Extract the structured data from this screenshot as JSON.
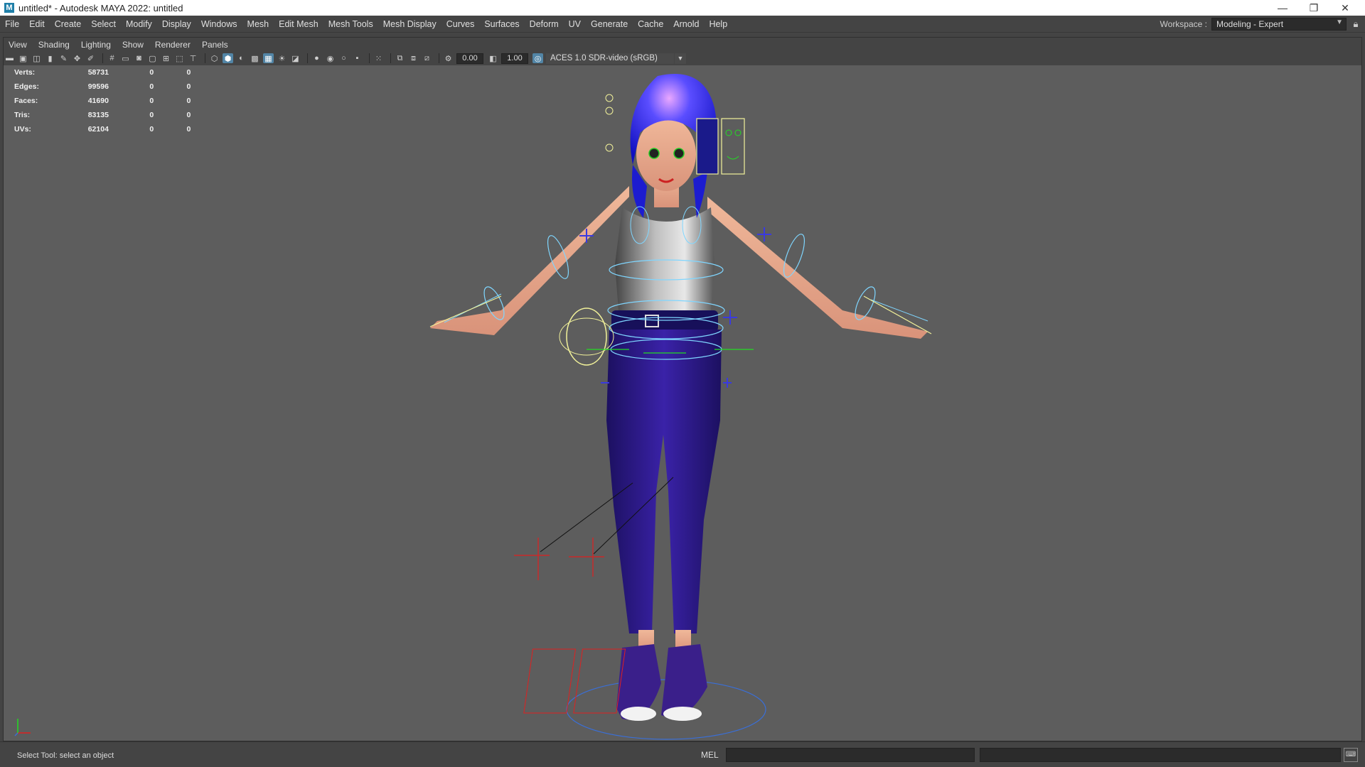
{
  "window": {
    "title": "untitled* - Autodesk MAYA 2022: untitled",
    "app_icon": "M",
    "controls": [
      "—",
      "❐",
      "✕"
    ]
  },
  "menubar": {
    "items": [
      "File",
      "Edit",
      "Create",
      "Select",
      "Modify",
      "Display",
      "Windows",
      "Mesh",
      "Edit Mesh",
      "Mesh Tools",
      "Mesh Display",
      "Curves",
      "Surfaces",
      "Deform",
      "UV",
      "Generate",
      "Cache",
      "Arnold",
      "Help"
    ]
  },
  "workspace": {
    "label": "Workspace :",
    "value": "Modeling - Expert"
  },
  "panel_menu": {
    "items": [
      "View",
      "Shading",
      "Lighting",
      "Show",
      "Renderer",
      "Panels"
    ]
  },
  "toolbar": {
    "exposure": "0.00",
    "gamma": "1.00",
    "color_space": "ACES 1.0 SDR-video (sRGB)"
  },
  "hud": {
    "rows": [
      {
        "label": "Verts:",
        "v1": "58731",
        "v2": "0",
        "v3": "0"
      },
      {
        "label": "Edges:",
        "v1": "99596",
        "v2": "0",
        "v3": "0"
      },
      {
        "label": "Faces:",
        "v1": "41690",
        "v2": "0",
        "v3": "0"
      },
      {
        "label": "Tris:",
        "v1": "83135",
        "v2": "0",
        "v3": "0"
      },
      {
        "label": "UVs:",
        "v1": "62104",
        "v2": "0",
        "v3": "0"
      }
    ]
  },
  "statusbar": {
    "help_text": "Select Tool: select an object",
    "command_language": "MEL"
  },
  "colors": {
    "viewport_bg": "#5d5d5d",
    "ui_bg": "#444444",
    "highlight": "#5285a6",
    "hair": "#2a2ae0",
    "pants": "#2a1a7a",
    "rig_cyan": "#7fd6ff",
    "rig_yellow": "#f2f29a",
    "rig_green": "#22dd22",
    "locator_red": "#e02020"
  }
}
